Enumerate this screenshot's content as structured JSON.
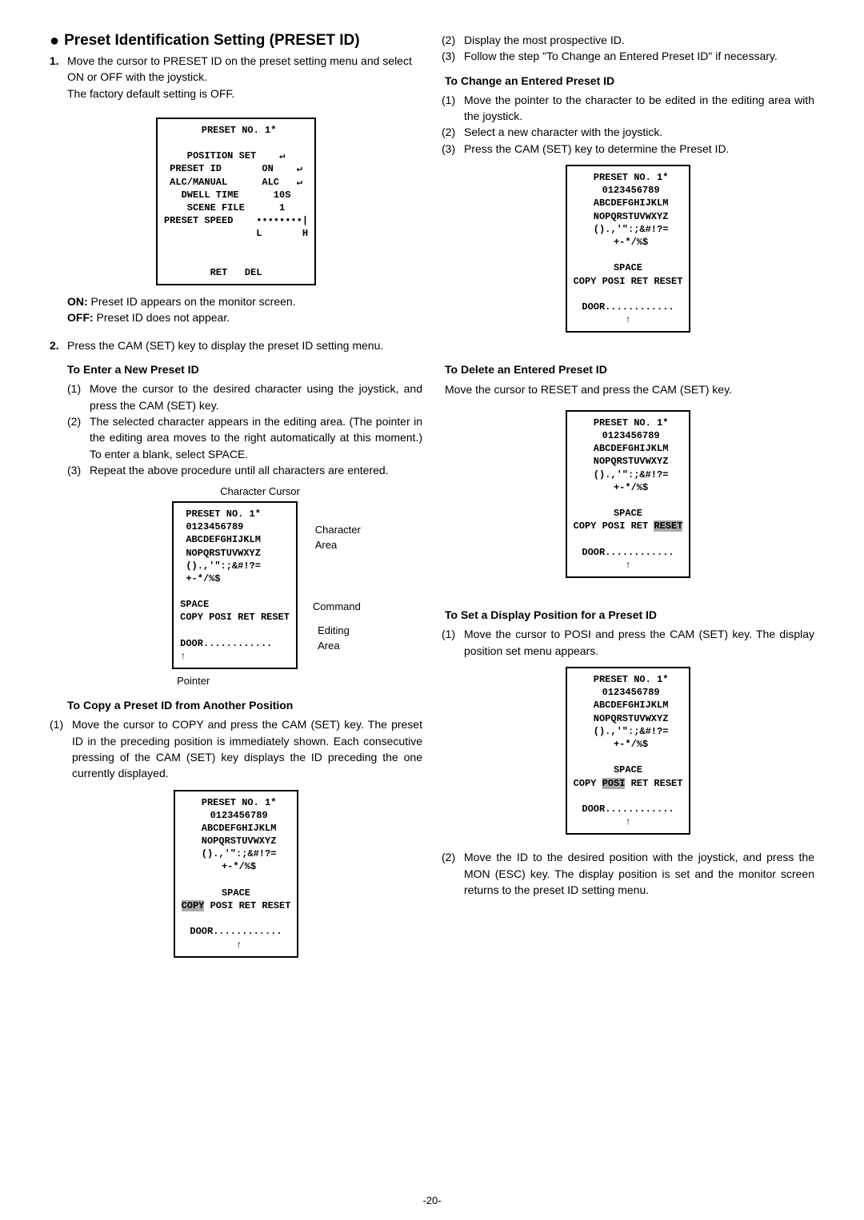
{
  "left": {
    "heading": "Preset Identification Setting (PRESET ID)",
    "step1_num": "1.",
    "step1_a": "Move the cursor to PRESET ID on the preset setting menu and select ON or OFF with the joystick.",
    "step1_b": "The factory default setting is OFF.",
    "menu1": " PRESET NO. 1*\n\nPOSITION SET    ↵\nPRESET ID       ON    ↵\nALC/MANUAL      ALC   ↵\nDWELL TIME      10S\nSCENE FILE      1\nPRESET SPEED    ••••••••|\n                L       H\n\n\nRET   DEL",
    "on_label": "ON:",
    "on_text": " Preset ID appears on the monitor screen.",
    "off_label": "OFF:",
    "off_text": " Preset ID does not appear.",
    "step2_num": "2.",
    "step2": "Press the CAM (SET) key to display the preset ID setting menu.",
    "sub1_title": "To Enter a New Preset ID",
    "s1_1n": "(1)",
    "s1_1": "Move the cursor to the desired character using the joystick, and press the CAM (SET) key.",
    "s1_2n": "(2)",
    "s1_2": "The selected character appears in the editing area. (The pointer in the editing area moves to the right automatically at this moment.) To enter a blank, select SPACE.",
    "s1_3n": "(3)",
    "s1_3": "Repeat the above procedure until all characters are entered.",
    "diag_label_cursor": "Character Cursor",
    "diag_label_chararea": "Character\nArea",
    "diag_label_command": "Command",
    "diag_label_editing": "Editing\nArea",
    "diag_label_pointer": "Pointer",
    "menu2": " PRESET NO. 1*\n 0123456789\n ABCDEFGHIJKLM\n NOPQRSTUVWXYZ\n ().,'\":;&#!?=\n +-*/%$\n\nSPACE\nCOPY POSI RET RESET\n\nDOOR............\n↑",
    "sub2_title": "To Copy a Preset ID from Another Position",
    "s2_1n": "(1)",
    "s2_1": "Move the cursor to COPY and press the CAM (SET) key. The preset ID in the preceding position is immediately shown. Each consecutive pressing of the CAM (SET) key displays the ID preceding the one currently displayed.",
    "menu3_pre": " PRESET NO. 1*\n 0123456789\n ABCDEFGHIJKLM\n NOPQRSTUVWXYZ\n ().,'\":;&#!?=\n +-*/%$\n\nSPACE\n",
    "menu3_copy": "COPY",
    "menu3_post": " POSI RET RESET\n\nDOOR............\n ↑"
  },
  "right": {
    "s_r2n": "(2)",
    "s_r2": "Display the most prospective ID.",
    "s_r3n": "(3)",
    "s_r3": "Follow the step \"To Change an Entered Preset ID\" if necessary.",
    "sub1_title": "To Change an Entered Preset ID",
    "c1n": "(1)",
    "c1": "Move the pointer to the character to be edited in the editing area with the joystick.",
    "c2n": "(2)",
    "c2": "Select a new character with the joystick.",
    "c3n": "(3)",
    "c3": "Press the CAM (SET) key to determine the Preset ID.",
    "menu4": " PRESET NO. 1*\n 0123456789\n ABCDEFGHIJKLM\n NOPQRSTUVWXYZ\n ().,'\":;&#!?=\n +-*/%$\n\nSPACE\nCOPY POSI RET RESET\n\nDOOR............\n↑",
    "sub2_title": "To Delete an Entered Preset ID",
    "del_text": "Move the cursor to RESET and press the CAM (SET) key.",
    "menu5_pre": " PRESET NO. 1*\n 0123456789\n ABCDEFGHIJKLM\n NOPQRSTUVWXYZ\n ().,'\":;&#!?=\n +-*/%$\n\nSPACE\nCOPY POSI RET ",
    "menu5_reset": "RESET",
    "menu5_post": "\n\nDOOR............\n↑",
    "sub3_title": "To Set a Display Position for a Preset ID",
    "p1n": "(1)",
    "p1": "Move the cursor to POSI and press the CAM (SET) key. The display position set menu appears.",
    "menu6_pre": " PRESET NO. 1*\n 0123456789\n ABCDEFGHIJKLM\n NOPQRSTUVWXYZ\n ().,'\":;&#!?=\n +-*/%$\n\nSPACE\nCOPY ",
    "menu6_posi": "POSI",
    "menu6_post": " RET RESET\n\nDOOR............\n↑",
    "p2n": "(2)",
    "p2": "Move the ID to the desired position with the joystick, and press the MON (ESC) key. The display position is set and the monitor screen returns to the preset ID setting menu."
  },
  "pagenum": "-20-"
}
